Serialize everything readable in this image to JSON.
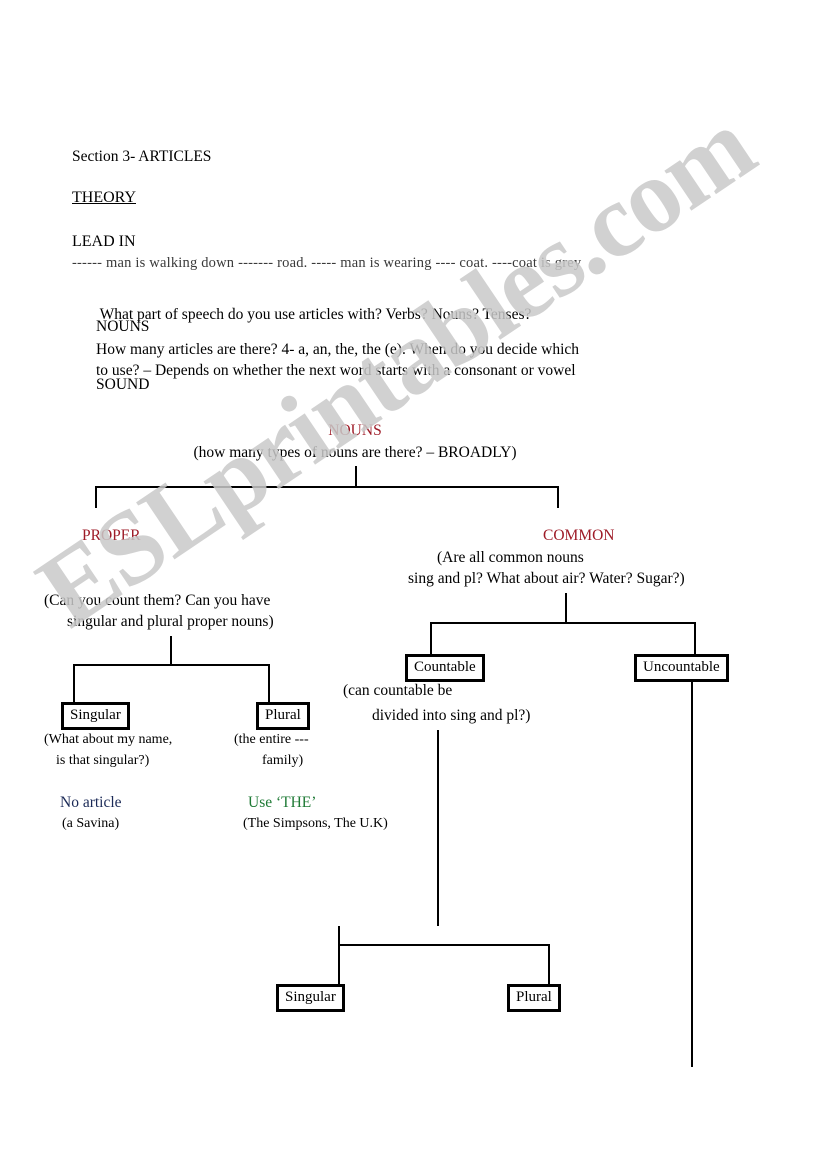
{
  "document": {
    "section_heading": "Section 3- ARTICLES",
    "theory_heading": "THEORY",
    "lead_in_heading": "LEAD IN",
    "lead_in_sentence": "------ man is walking down ------- road. ----- man is wearing ---- coat. ----coat is grey",
    "intro": {
      "line1": " What part of speech do you use articles with? Verbs? Nouns? Tenses?",
      "line2": "NOUNS",
      "line3": "How many articles are there? 4- a, an, the, the (e). When do you decide which",
      "line4": "to use? – Depends on whether the next word starts with a consonant or vowel",
      "line5": "SOUND"
    }
  },
  "diagram": {
    "root": {
      "label": "NOUNS",
      "note": "(how many types of nouns are there? – BROADLY)"
    },
    "proper": {
      "label": "PROPER",
      "note_line1": "(Can you count them? Can you have",
      "note_line2": "singular and plural proper nouns)",
      "singular": {
        "box_label": "Singular",
        "note_line1": "(What about my name,",
        "note_line2": "is that singular?)",
        "rule": "No article",
        "example": "(a Savina)"
      },
      "plural": {
        "box_label": "Plural",
        "note_line1": "(the entire ---",
        "note_line2": "family)",
        "rule": "Use ‘THE’",
        "example": "(The Simpsons, The U.K)"
      }
    },
    "common": {
      "label": "COMMON",
      "note_line1": "(Are all common nouns",
      "note_line2": "sing and pl? What about air? Water? Sugar?)",
      "countable": {
        "box_label": "Countable",
        "note_line1": "(can countable be",
        "note_line2": "divided into sing and pl?)",
        "singular_box_label": "Singular",
        "plural_box_label": "Plural"
      },
      "uncountable": {
        "box_label": "Uncountable"
      }
    }
  },
  "watermark": {
    "text": "ESLprintables.com"
  },
  "colors": {
    "heading_red": "#9e1b27",
    "rule_navy": "#1b2a57",
    "rule_green": "#1f7a36",
    "watermark_gray": "#c9c9c9",
    "line_black": "#000000"
  }
}
